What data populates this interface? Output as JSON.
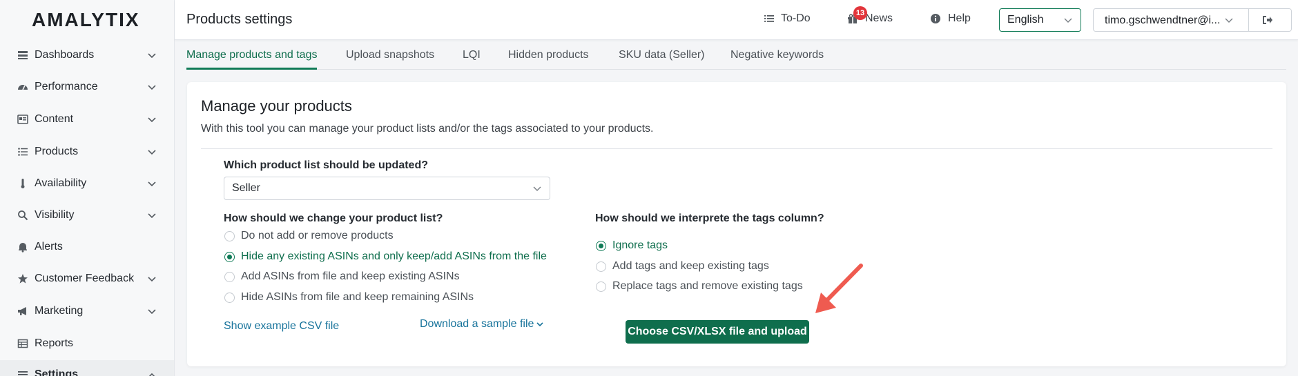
{
  "logo": "AMALYTIX",
  "sidebar": {
    "items": [
      {
        "label": "Dashboards",
        "icon": "dashboard-icon",
        "chevron": true
      },
      {
        "label": "Performance",
        "icon": "gauge-icon",
        "chevron": true
      },
      {
        "label": "Content",
        "icon": "content-icon",
        "chevron": true
      },
      {
        "label": "Products",
        "icon": "list-icon",
        "chevron": true
      },
      {
        "label": "Availability",
        "icon": "thermometer-icon",
        "chevron": true
      },
      {
        "label": "Visibility",
        "icon": "search-icon",
        "chevron": true
      },
      {
        "label": "Alerts",
        "icon": "bell-icon",
        "chevron": false
      },
      {
        "label": "Customer Feedback",
        "icon": "star-icon",
        "chevron": true
      },
      {
        "label": "Marketing",
        "icon": "megaphone-icon",
        "chevron": true
      },
      {
        "label": "Reports",
        "icon": "table-icon",
        "chevron": false
      },
      {
        "label": "Settings",
        "icon": "settings-icon",
        "chevron": true
      }
    ]
  },
  "header": {
    "title": "Products settings",
    "todo_label": "To-Do",
    "news_label": "News",
    "news_count": "13",
    "help_label": "Help",
    "language": "English",
    "user": "timo.gschwendtner@i..."
  },
  "tabs": [
    {
      "label": "Manage products and tags",
      "active": true
    },
    {
      "label": "Upload snapshots",
      "active": false
    },
    {
      "label": "LQI",
      "active": false
    },
    {
      "label": "Hidden products",
      "active": false
    },
    {
      "label": "SKU data (Seller)",
      "active": false
    },
    {
      "label": "Negative keywords",
      "active": false
    }
  ],
  "main": {
    "heading": "Manage your products",
    "description": "With this tool you can manage your product lists and/or the tags associated to your products.",
    "product_list_question": "Which product list should be updated?",
    "product_list_value": "Seller",
    "change_question": "How should we change your product list?",
    "change_options": [
      {
        "label": "Do not add or remove products",
        "checked": false
      },
      {
        "label": "Hide any existing ASINs and only keep/add ASINs from the file",
        "checked": true
      },
      {
        "label": "Add ASINs from file and keep existing ASINs",
        "checked": false
      },
      {
        "label": "Hide ASINs from file and keep remaining ASINs",
        "checked": false
      }
    ],
    "tags_question": "How should we interprete the tags column?",
    "tags_options": [
      {
        "label": "Ignore tags",
        "checked": true
      },
      {
        "label": "Add tags and keep existing tags",
        "checked": false
      },
      {
        "label": "Replace tags and remove existing tags",
        "checked": false
      }
    ],
    "show_example_label": "Show example CSV file",
    "download_sample_label": "Download a sample file",
    "upload_button_label": "Choose CSV/XLSX file and upload"
  },
  "colors": {
    "accent": "#0f7a56",
    "link": "#17739b",
    "badge": "#e2353b",
    "annotation_arrow": "#ef5b50"
  }
}
